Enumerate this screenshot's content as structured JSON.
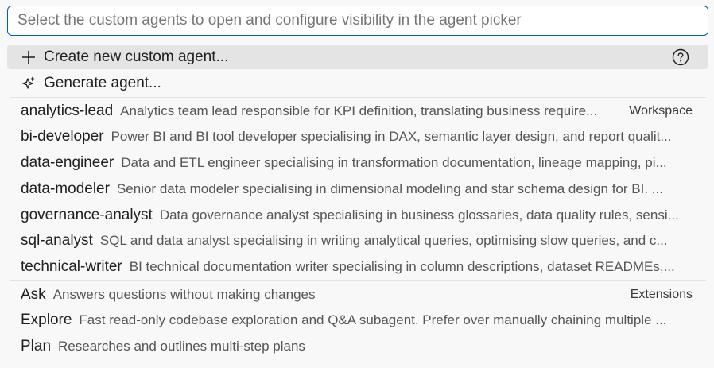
{
  "search": {
    "placeholder": "Select the custom agents to open and configure visibility in the agent picker"
  },
  "actions": {
    "create_label": "Create new custom agent...",
    "generate_label": "Generate agent..."
  },
  "groups": {
    "workspace_label": "Workspace",
    "extensions_label": "Extensions"
  },
  "workspace_agents": [
    {
      "name": "analytics-lead",
      "description": "Analytics team lead responsible for KPI definition, translating business require..."
    },
    {
      "name": "bi-developer",
      "description": "Power BI and BI tool developer specialising in DAX, semantic layer design, and report qualit..."
    },
    {
      "name": "data-engineer",
      "description": "Data and ETL engineer specialising in transformation documentation, lineage mapping, pi..."
    },
    {
      "name": "data-modeler",
      "description": "Senior data modeler specialising in dimensional modeling and star schema design for BI. ..."
    },
    {
      "name": "governance-analyst",
      "description": "Data governance analyst specialising in business glossaries, data quality rules, sensi..."
    },
    {
      "name": "sql-analyst",
      "description": "SQL and data analyst specialising in writing analytical queries, optimising slow queries, and c..."
    },
    {
      "name": "technical-writer",
      "description": "BI technical documentation writer specialising in column descriptions, dataset READMEs,..."
    }
  ],
  "extension_agents": [
    {
      "name": "Ask",
      "description": "Answers questions without making changes"
    },
    {
      "name": "Explore",
      "description": "Fast read-only codebase exploration and Q&A subagent. Prefer over manually chaining multiple ..."
    },
    {
      "name": "Plan",
      "description": "Researches and outlines multi-step plans"
    }
  ]
}
